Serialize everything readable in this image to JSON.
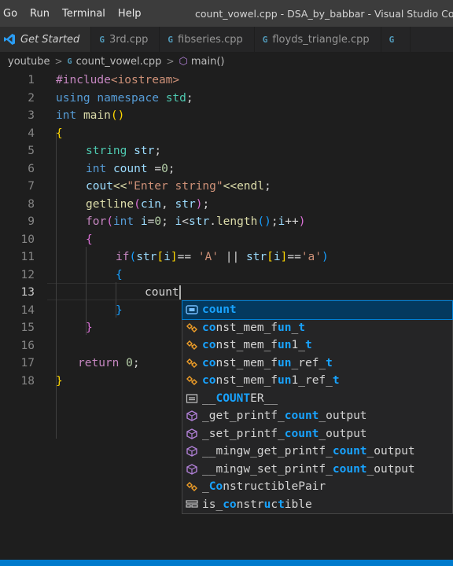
{
  "menu": [
    "Go",
    "Run",
    "Terminal",
    "Help"
  ],
  "window_title": "count_vowel.cpp - DSA_by_babbar - Visual Studio Code",
  "tabs": [
    {
      "label": "Get Started",
      "icon": "vscode-icon"
    },
    {
      "label": "3rd.cpp",
      "icon": "cpp-file-icon"
    },
    {
      "label": "fibseries.cpp",
      "icon": "cpp-file-icon"
    },
    {
      "label": "floyds_triangle.cpp",
      "icon": "cpp-file-icon"
    },
    {
      "label": "",
      "icon": "cpp-file-icon"
    }
  ],
  "breadcrumb": {
    "folder": "youtube",
    "file": "count_vowel.cpp",
    "symbol": "main()",
    "sep": ">"
  },
  "line_numbers": [
    "1",
    "2",
    "3",
    "4",
    "5",
    "6",
    "7",
    "8",
    "9",
    "10",
    "11",
    "12",
    "13",
    "14",
    "15",
    "16",
    "17",
    "18"
  ],
  "code": {
    "l1_pre": "#include",
    "l1_inc": "<iostream>",
    "l2_using": "using",
    "l2_ns": "namespace",
    "l2_std": "std",
    "l2_semi": ";",
    "l3_int": "int",
    "l3_main": "main",
    "l3_parens": "()",
    "l4_brace": "{",
    "l5_type": "string",
    "l5_var": "str",
    "l5_semi": ";",
    "l6_int": "int",
    "l6_var": "count",
    "l6_eq": " =",
    "l6_num": "0",
    "l6_semi": ";",
    "l7_cout": "cout",
    "l7_op": "<<",
    "l7_str": "\"Enter string\"",
    "l7_op2": "<<",
    "l7_endl": "endl",
    "l7_semi": ";",
    "l8_fn": "getline",
    "l8_open": "(",
    "l8_cin": "cin",
    "l8_comma": ", ",
    "l8_str": "str",
    "l8_close": ")",
    "l8_semi": ";",
    "l9_for": "for",
    "l9_open": "(",
    "l9_int": "int",
    "l9_i": "i",
    "l9_eq": "=",
    "l9_zero": "0",
    "l9_semi1": "; ",
    "l9_i2": "i",
    "l9_lt": "<",
    "l9_str": "str",
    "l9_dot": ".",
    "l9_len": "length",
    "l9_lparens": "()",
    "l9_semi2": ";",
    "l9_i3": "i",
    "l9_inc": "++",
    "l9_close": ")",
    "l10_brace": "{",
    "l11_if": "if",
    "l11_open": "(",
    "l11_str1": "str",
    "l11_lb1": "[",
    "l11_i1": "i",
    "l11_rb1": "]",
    "l11_eq1": "== ",
    "l11_ch1": "'A'",
    "l11_or": " || ",
    "l11_str2": "str",
    "l11_lb2": "[",
    "l11_i2": "i",
    "l11_rb2": "]",
    "l11_eq2": "==",
    "l11_ch2": "'a'",
    "l11_close": ")",
    "l12_brace": "{",
    "l13_text": "count",
    "l14_brace": "}",
    "l15_brace": "}",
    "l17_return": "return",
    "l17_zero": "0",
    "l17_semi": ";",
    "l18_brace": "}"
  },
  "suggestions": [
    {
      "icon": "variable-icon",
      "parts": [
        {
          "t": "count",
          "hl": true
        }
      ],
      "selected": true
    },
    {
      "icon": "class-icon",
      "parts": [
        {
          "t": "co",
          "hl": true
        },
        {
          "t": "nst_mem_f",
          "hl": false
        },
        {
          "t": "un",
          "hl": true
        },
        {
          "t": "_",
          "hl": false
        },
        {
          "t": "t",
          "hl": true
        }
      ],
      "selected": false
    },
    {
      "icon": "class-icon",
      "parts": [
        {
          "t": "co",
          "hl": true
        },
        {
          "t": "nst_mem_f",
          "hl": false
        },
        {
          "t": "un",
          "hl": true
        },
        {
          "t": "1_",
          "hl": false
        },
        {
          "t": "t",
          "hl": true
        }
      ],
      "selected": false
    },
    {
      "icon": "class-icon",
      "parts": [
        {
          "t": "co",
          "hl": true
        },
        {
          "t": "nst_mem_f",
          "hl": false
        },
        {
          "t": "un",
          "hl": true
        },
        {
          "t": "_ref_",
          "hl": false
        },
        {
          "t": "t",
          "hl": true
        }
      ],
      "selected": false
    },
    {
      "icon": "class-icon",
      "parts": [
        {
          "t": "co",
          "hl": true
        },
        {
          "t": "nst_mem_f",
          "hl": false
        },
        {
          "t": "un",
          "hl": true
        },
        {
          "t": "1_ref_",
          "hl": false
        },
        {
          "t": "t",
          "hl": true
        }
      ],
      "selected": false
    },
    {
      "icon": "constant-icon",
      "parts": [
        {
          "t": "__",
          "hl": false
        },
        {
          "t": "COUNT",
          "hl": true
        },
        {
          "t": "ER__",
          "hl": false
        }
      ],
      "selected": false
    },
    {
      "icon": "method-icon",
      "parts": [
        {
          "t": "_get_printf_",
          "hl": false
        },
        {
          "t": "count",
          "hl": true
        },
        {
          "t": "_output",
          "hl": false
        }
      ],
      "selected": false
    },
    {
      "icon": "method-icon",
      "parts": [
        {
          "t": "_set_printf_",
          "hl": false
        },
        {
          "t": "count",
          "hl": true
        },
        {
          "t": "_output",
          "hl": false
        }
      ],
      "selected": false
    },
    {
      "icon": "method-icon",
      "parts": [
        {
          "t": "__mingw_get_printf_",
          "hl": false
        },
        {
          "t": "count",
          "hl": true
        },
        {
          "t": "_output",
          "hl": false
        }
      ],
      "selected": false
    },
    {
      "icon": "method-icon",
      "parts": [
        {
          "t": "__mingw_set_printf_",
          "hl": false
        },
        {
          "t": "count",
          "hl": true
        },
        {
          "t": "_output",
          "hl": false
        }
      ],
      "selected": false
    },
    {
      "icon": "class-icon",
      "parts": [
        {
          "t": "_",
          "hl": false
        },
        {
          "t": "C",
          "hl": true
        },
        {
          "t": "o",
          "hl": true
        },
        {
          "t": "n",
          "hl": false
        },
        {
          "t": "structiblePair",
          "hl": false
        }
      ],
      "selected": false
    },
    {
      "icon": "keyword-icon",
      "parts": [
        {
          "t": "is_",
          "hl": false
        },
        {
          "t": "co",
          "hl": true
        },
        {
          "t": "nstr",
          "hl": false
        },
        {
          "t": "u",
          "hl": true
        },
        {
          "t": "c",
          "hl": false
        },
        {
          "t": "t",
          "hl": true
        },
        {
          "t": "ible",
          "hl": false
        }
      ],
      "selected": false
    }
  ],
  "colors": {
    "accent": "#007acc",
    "selection": "#04395e",
    "match_highlight": "#18a3ff"
  }
}
